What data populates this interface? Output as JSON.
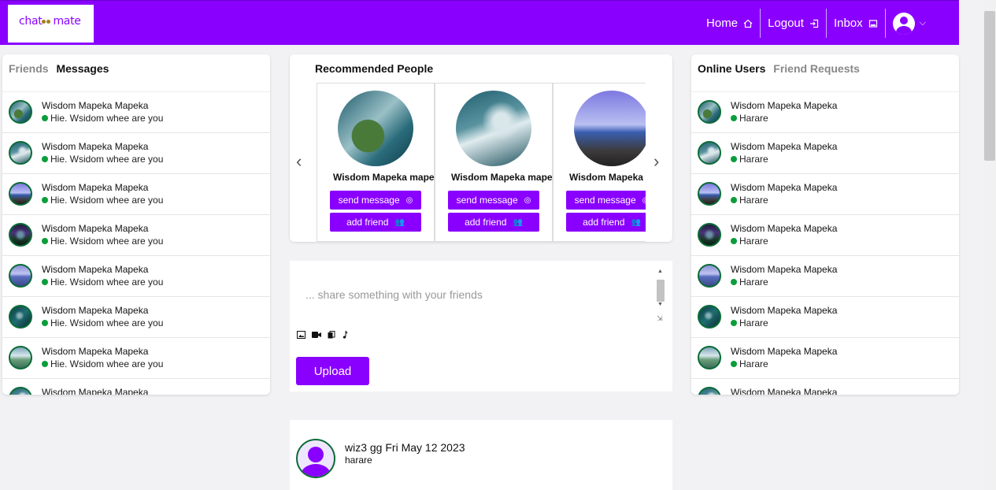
{
  "brand": {
    "logo_text": "chat",
    "logo_text2": "mate"
  },
  "nav": {
    "items": [
      {
        "label": "Home",
        "icon": "home-icon"
      },
      {
        "label": "Logout",
        "icon": "logout-icon"
      },
      {
        "label": "Inbox",
        "icon": "inbox-icon"
      }
    ],
    "avatar_icon": "user-avatar-icon",
    "chevron": "⌄"
  },
  "left_panel": {
    "tabs": [
      {
        "label": "Friends",
        "active": false
      },
      {
        "label": "Messages",
        "active": true
      }
    ],
    "items": [
      {
        "name": "Wisdom Mapeka Mapeka",
        "message": "Hie. Wsidom whee are you"
      },
      {
        "name": "Wisdom Mapeka Mapeka",
        "message": "Hie. Wsidom whee are you"
      },
      {
        "name": "Wisdom Mapeka Mapeka",
        "message": "Hie. Wsidom whee are you"
      },
      {
        "name": "Wisdom Mapeka Mapeka",
        "message": "Hie. Wsidom whee are you"
      },
      {
        "name": "Wisdom Mapeka Mapeka",
        "message": "Hie. Wsidom whee are you"
      },
      {
        "name": "Wisdom Mapeka Mapeka",
        "message": "Hie. Wsidom whee are you"
      },
      {
        "name": "Wisdom Mapeka Mapeka",
        "message": "Hie. Wsidom whee are you"
      },
      {
        "name": "Wisdom Mapeka Mapeka",
        "message": ""
      }
    ]
  },
  "recommended": {
    "title": "Recommended People",
    "prev": "‹",
    "next": "›",
    "cards": [
      {
        "name": "Wisdom Mapeka mapeka",
        "send_label": "send message",
        "add_label": "add friend"
      },
      {
        "name": "Wisdom Mapeka mapeka",
        "send_label": "send message",
        "add_label": "add friend"
      },
      {
        "name": "Wisdom Mapeka",
        "send_label": "send message",
        "add_label": "add friend"
      }
    ]
  },
  "composer": {
    "placeholder": "... share something with your friends",
    "upload_label": "Upload",
    "media_icons": [
      "image-icon",
      "video-icon",
      "document-icon",
      "music-icon"
    ]
  },
  "post": {
    "title": "wiz3 gg Fri May 12 2023",
    "location": "harare"
  },
  "right_panel": {
    "tabs": [
      {
        "label": "Online Users",
        "active": true
      },
      {
        "label": "Friend Requests",
        "active": false
      }
    ],
    "items": [
      {
        "name": "Wisdom Mapeka Mapeka",
        "location": "Harare"
      },
      {
        "name": "Wisdom Mapeka Mapeka",
        "location": "Harare"
      },
      {
        "name": "Wisdom Mapeka Mapeka",
        "location": "Harare"
      },
      {
        "name": "Wisdom Mapeka Mapeka",
        "location": "Harare"
      },
      {
        "name": "Wisdom Mapeka Mapeka",
        "location": "Harare"
      },
      {
        "name": "Wisdom Mapeka Mapeka",
        "location": "Harare"
      },
      {
        "name": "Wisdom Mapeka Mapeka",
        "location": "Harare"
      },
      {
        "name": "Wisdom Mapeka Mapeka",
        "location": ""
      }
    ]
  },
  "colors": {
    "brand": "#8a00ff",
    "online": "#0a9d3a"
  }
}
